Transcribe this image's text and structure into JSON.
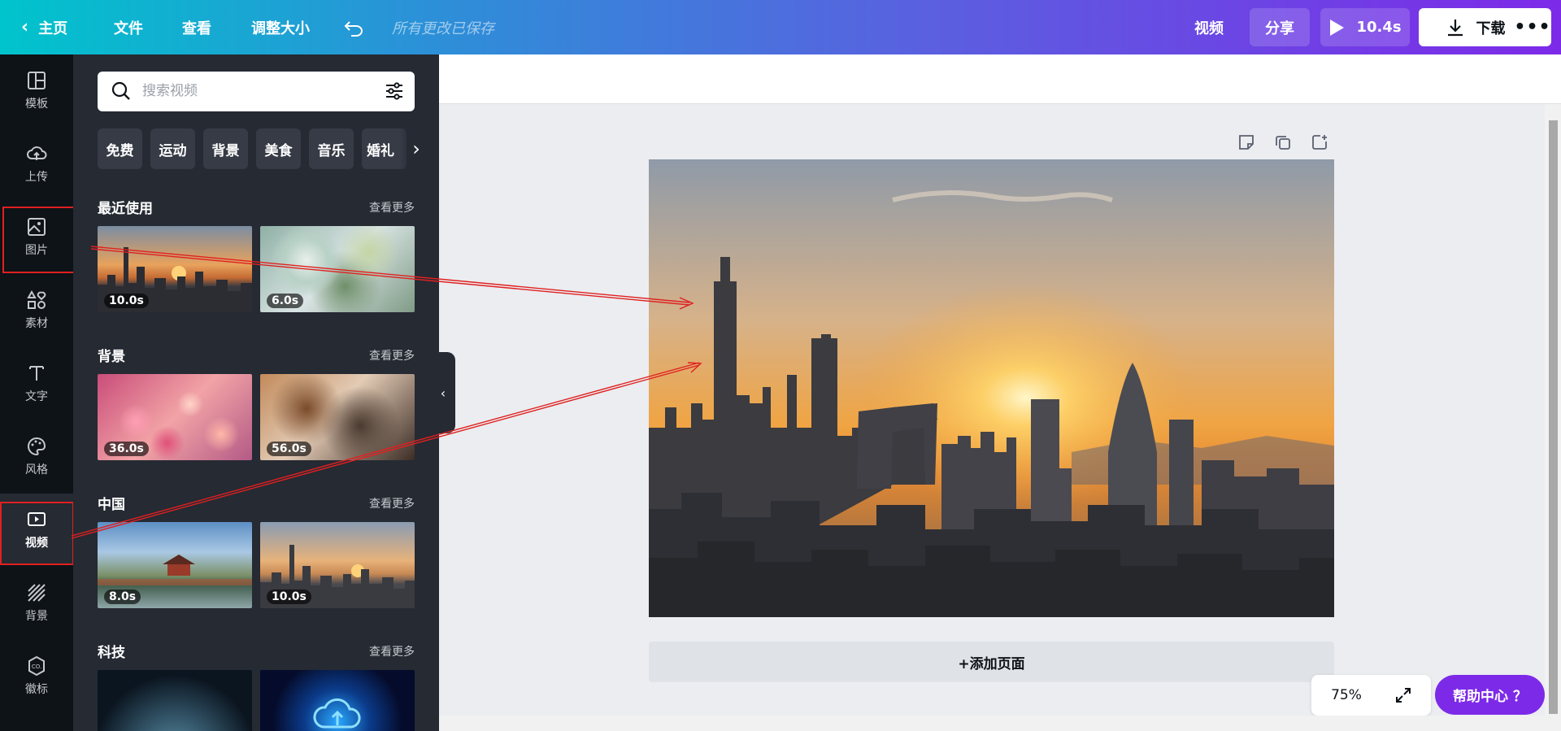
{
  "topbar": {
    "home_label": "主页",
    "file_label": "文件",
    "view_label": "查看",
    "resize_label": "调整大小",
    "saved_status": "所有更改已保存",
    "video_label": "视频",
    "share_label": "分享",
    "play_duration": "10.4s",
    "download_label": "下载"
  },
  "rail": {
    "items": [
      {
        "label": "模板",
        "icon": "template-icon"
      },
      {
        "label": "上传",
        "icon": "upload-cloud-icon"
      },
      {
        "label": "图片",
        "icon": "image-icon"
      },
      {
        "label": "素材",
        "icon": "elements-icon"
      },
      {
        "label": "文字",
        "icon": "text-icon"
      },
      {
        "label": "风格",
        "icon": "palette-icon"
      },
      {
        "label": "视频",
        "icon": "video-icon"
      },
      {
        "label": "背景",
        "icon": "background-icon"
      },
      {
        "label": "徽标",
        "icon": "logo-icon"
      }
    ],
    "active": "视频"
  },
  "panel": {
    "search_placeholder": "搜索视频",
    "chips": [
      "免费",
      "运动",
      "背景",
      "美食",
      "音乐",
      "婚礼"
    ],
    "see_more": "查看更多",
    "sections": [
      {
        "title": "最近使用",
        "items": [
          {
            "duration": "10.0s"
          },
          {
            "duration": "6.0s"
          }
        ]
      },
      {
        "title": "背景",
        "items": [
          {
            "duration": "36.0s"
          },
          {
            "duration": "56.0s"
          }
        ]
      },
      {
        "title": "中国",
        "items": [
          {
            "duration": "8.0s"
          },
          {
            "duration": "10.0s"
          }
        ]
      },
      {
        "title": "科技",
        "items": [
          {
            "duration": ""
          },
          {
            "duration": ""
          }
        ]
      }
    ]
  },
  "workspace": {
    "add_page_label": "+添加页面",
    "zoom_level": "75%",
    "help_label": "帮助中心 ？"
  },
  "colors": {
    "accent_purple": "#7d2ae8",
    "gradient_start": "#00c4cc",
    "annotation_red": "#e02020",
    "panel_bg": "#252a33",
    "rail_bg": "#0e1318"
  }
}
